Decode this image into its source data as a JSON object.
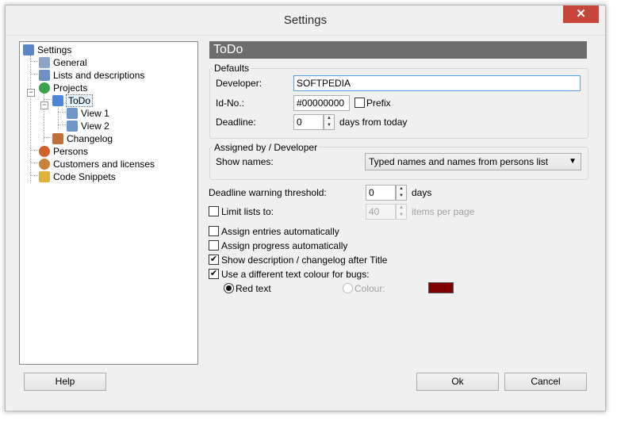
{
  "window": {
    "title": "Settings",
    "close_glyph": "✕"
  },
  "tree": {
    "items": [
      {
        "label": "Settings",
        "icon": "settings-icon",
        "color": "#5a86c9"
      },
      {
        "label": "General",
        "icon": "general-icon",
        "color": "#8aa4c8"
      },
      {
        "label": "Lists and descriptions",
        "icon": "list-icon",
        "color": "#6d91c5"
      },
      {
        "label": "Projects",
        "icon": "projects-icon",
        "color": "#3aa04a"
      },
      {
        "label": "ToDo",
        "icon": "todo-icon",
        "color": "#4d86d4"
      },
      {
        "label": "View 1",
        "icon": "view-icon",
        "color": "#6c95c9"
      },
      {
        "label": "View 2",
        "icon": "view-icon",
        "color": "#6c95c9"
      },
      {
        "label": "Changelog",
        "icon": "changelog-icon",
        "color": "#c0703b"
      },
      {
        "label": "Persons",
        "icon": "persons-icon",
        "color": "#d0612a"
      },
      {
        "label": "Customers and licenses",
        "icon": "customers-icon",
        "color": "#c8843a"
      },
      {
        "label": "Code Snippets",
        "icon": "snippets-icon",
        "color": "#e0b23a"
      }
    ],
    "expander_open": "−"
  },
  "panel": {
    "header": "ToDo",
    "defaults": {
      "legend": "Defaults",
      "developer_label": "Developer:",
      "developer_value": "SOFTPEDIA",
      "id_label": "Id-No.:",
      "id_value": "#00000000",
      "prefix_label": "Prefix",
      "deadline_label": "Deadline:",
      "deadline_value": "0",
      "deadline_suffix": "days from today"
    },
    "assigned": {
      "legend": "Assigned by / Developer",
      "show_names_label": "Show names:",
      "show_names_value": "Typed names and names from persons list"
    },
    "threshold_label": "Deadline warning threshold:",
    "threshold_value": "0",
    "threshold_suffix": "days",
    "limit_label": "Limit lists to:",
    "limit_value": "40",
    "limit_suffix": "items per page",
    "checks": [
      {
        "label": "Assign entries automatically",
        "checked": false
      },
      {
        "label": "Assign progress automatically",
        "checked": false
      },
      {
        "label": "Show description / changelog after Title",
        "checked": true
      },
      {
        "label": "Use a different text colour for bugs:",
        "checked": true
      }
    ],
    "red_text_label": "Red text",
    "colour_label": "Colour:",
    "bug_colour": "#800000"
  },
  "buttons": {
    "help": "Help",
    "ok": "Ok",
    "cancel": "Cancel"
  },
  "check_glyph": "✔",
  "spin_up": "▲",
  "spin_down": "▼",
  "combo_arrow": "▼"
}
